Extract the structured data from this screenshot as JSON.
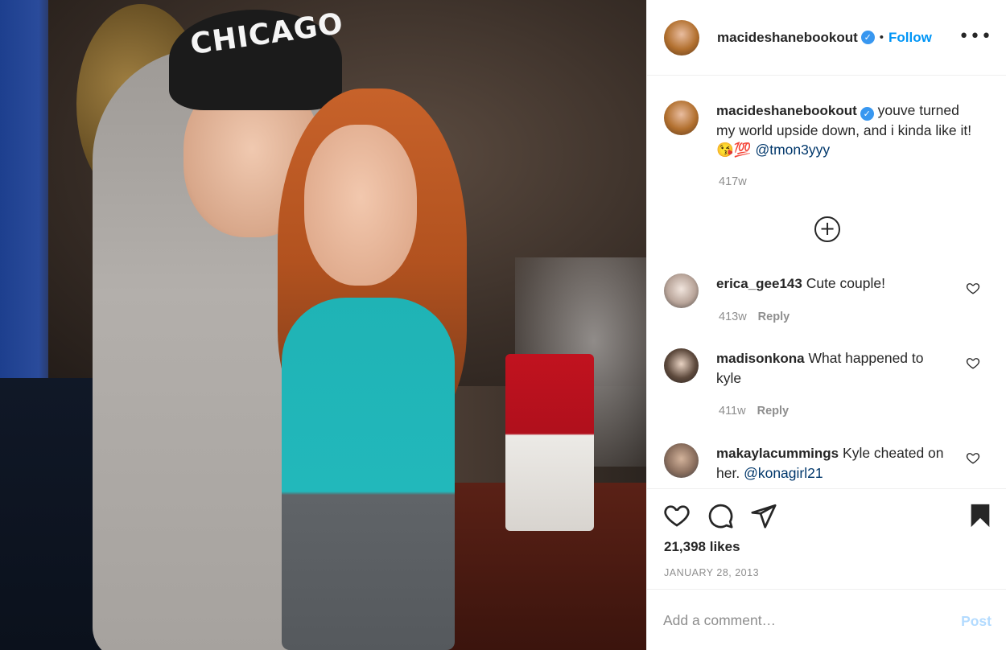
{
  "post": {
    "author": "macideshanebookout",
    "verified_symbol": "✓",
    "dot": "•",
    "follow_label": "Follow",
    "more_label": "•••",
    "cap_text": "CHICAGO",
    "caption": {
      "username": "macideshanebookout",
      "text": "youve turned my world upside down, and i kinda like it! 😘💯",
      "mention": "@tmon3yyy",
      "time": "417w"
    },
    "load_more_icon": "plus-circle-icon",
    "load_more_symbol": "+",
    "comments": [
      {
        "username": "erica_gee143",
        "text": "Cute couple!",
        "time": "413w",
        "reply_label": "Reply"
      },
      {
        "username": "madisonkona",
        "text": "What happened to kyle",
        "time": "411w",
        "reply_label": "Reply"
      },
      {
        "username": "makaylacummings",
        "text": "Kyle cheated on her.",
        "mention": "@konagirl21"
      }
    ],
    "likes": "21,398 likes",
    "date": "JANUARY 28, 2013"
  },
  "compose": {
    "placeholder": "Add a comment…",
    "post_label": "Post"
  },
  "icons": {
    "like": "heart-icon",
    "comment": "comment-icon",
    "share": "paper-plane-icon",
    "save": "bookmark-icon"
  },
  "colors": {
    "accent": "#0095f6",
    "verified": "#3897f0",
    "muted": "#8e8e8e",
    "mention": "#00376b",
    "post_disabled": "#b3dbff"
  }
}
